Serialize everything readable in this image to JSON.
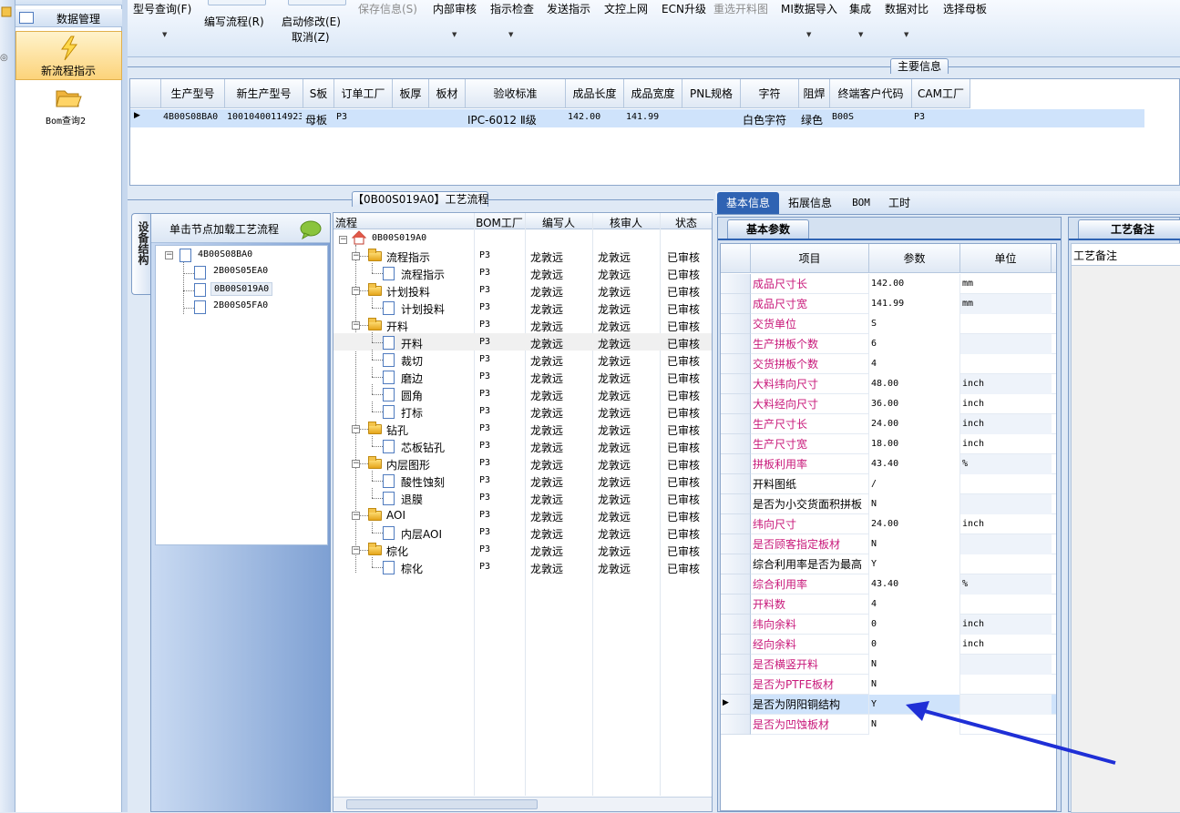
{
  "left_nav": {
    "top_partial": "... ",
    "data_mgmt": "数据管理",
    "new_flow": "新流程指示",
    "bom_query": "Bom查询2"
  },
  "toolbar": {
    "model_query": "型号查询(F)",
    "write_flow": "编写流程(R)",
    "start_modify": "启动修改(E)",
    "cancel": "取消(Z)",
    "save_info": "保存信息(S)",
    "internal_audit": "内部审核",
    "instruction_check": "指示检查",
    "send_instruction": "发送指示",
    "doc_online": "文控上网",
    "ecn_upgrade": "ECN升级",
    "reselect_panel": "重选开料图",
    "mi_import": "MI数据导入",
    "integrate": "集成",
    "data_compare": "数据对比",
    "select_master": "选择母板"
  },
  "main_info": {
    "title": "主要信息",
    "columns": [
      "生产型号",
      "新生产型号",
      "S板",
      "订单工厂",
      "板厚",
      "板材",
      "验收标准",
      "成品长度",
      "成品宽度",
      "PNL规格",
      "字符",
      "阻焊",
      "终端客户代码",
      "CAM工厂"
    ],
    "row": [
      "4B00S08BA0",
      "10010400114923",
      "母板",
      "P3",
      "",
      "",
      "IPC-6012 Ⅱ级",
      "142.00",
      "141.99",
      "",
      "白色字符",
      "绿色",
      "B00S",
      "P3"
    ]
  },
  "flow_panel": {
    "title": "【0B00S019A0】工艺流程",
    "side_tab": "设备结构",
    "hint": "单击节点加载工艺流程",
    "tree": [
      "4B00S08BA0",
      "2B00S05EA0",
      "0B00S019A0",
      "2B00S05FA0"
    ]
  },
  "flow_grid": {
    "columns": [
      "流程",
      "BOM工厂",
      "编写人",
      "核审人",
      "状态"
    ],
    "root": "0B00S019A0",
    "rows": [
      {
        "name": "流程指示",
        "type": "folder",
        "factory": "P3",
        "writer": "龙敦远",
        "auditor": "龙敦远",
        "status": "已审核"
      },
      {
        "name": "流程指示",
        "type": "doc",
        "factory": "P3",
        "writer": "龙敦远",
        "auditor": "龙敦远",
        "status": "已审核"
      },
      {
        "name": "计划投料",
        "type": "folder",
        "factory": "P3",
        "writer": "龙敦远",
        "auditor": "龙敦远",
        "status": "已审核"
      },
      {
        "name": "计划投料",
        "type": "doc",
        "factory": "P3",
        "writer": "龙敦远",
        "auditor": "龙敦远",
        "status": "已审核"
      },
      {
        "name": "开料",
        "type": "folder",
        "factory": "P3",
        "writer": "龙敦远",
        "auditor": "龙敦远",
        "status": "已审核"
      },
      {
        "name": "开料",
        "type": "doc",
        "factory": "P3",
        "writer": "龙敦远",
        "auditor": "龙敦远",
        "status": "已审核"
      },
      {
        "name": "裁切",
        "type": "doc",
        "factory": "P3",
        "writer": "龙敦远",
        "auditor": "龙敦远",
        "status": "已审核"
      },
      {
        "name": "磨边",
        "type": "doc",
        "factory": "P3",
        "writer": "龙敦远",
        "auditor": "龙敦远",
        "status": "已审核"
      },
      {
        "name": "圆角",
        "type": "doc",
        "factory": "P3",
        "writer": "龙敦远",
        "auditor": "龙敦远",
        "status": "已审核"
      },
      {
        "name": "打标",
        "type": "doc",
        "factory": "P3",
        "writer": "龙敦远",
        "auditor": "龙敦远",
        "status": "已审核"
      },
      {
        "name": "钻孔",
        "type": "folder",
        "factory": "P3",
        "writer": "龙敦远",
        "auditor": "龙敦远",
        "status": "已审核"
      },
      {
        "name": "芯板钻孔",
        "type": "doc",
        "factory": "P3",
        "writer": "龙敦远",
        "auditor": "龙敦远",
        "status": "已审核"
      },
      {
        "name": "内层图形",
        "type": "folder",
        "factory": "P3",
        "writer": "龙敦远",
        "auditor": "龙敦远",
        "status": "已审核"
      },
      {
        "name": "酸性蚀刻",
        "type": "doc",
        "factory": "P3",
        "writer": "龙敦远",
        "auditor": "龙敦远",
        "status": "已审核"
      },
      {
        "name": "退膜",
        "type": "doc",
        "factory": "P3",
        "writer": "龙敦远",
        "auditor": "龙敦远",
        "status": "已审核"
      },
      {
        "name": "AOI",
        "type": "folder",
        "factory": "P3",
        "writer": "龙敦远",
        "auditor": "龙敦远",
        "status": "已审核"
      },
      {
        "name": "内层AOI",
        "type": "doc",
        "factory": "P3",
        "writer": "龙敦远",
        "auditor": "龙敦远",
        "status": "已审核"
      },
      {
        "name": "棕化",
        "type": "folder",
        "factory": "P3",
        "writer": "龙敦远",
        "auditor": "龙敦远",
        "status": "已审核"
      },
      {
        "name": "棕化",
        "type": "doc",
        "factory": "P3",
        "writer": "龙敦远",
        "auditor": "龙敦远",
        "status": "已审核"
      }
    ]
  },
  "right_tabs": [
    "基本信息",
    "拓展信息",
    "BOM",
    "工时"
  ],
  "basic_params": {
    "title": "基本参数",
    "columns": [
      "项目",
      "参数",
      "单位"
    ],
    "rows": [
      {
        "name": "成品尺寸长",
        "value": "142.00",
        "unit": "mm",
        "pink": true
      },
      {
        "name": "成品尺寸宽",
        "value": "141.99",
        "unit": "mm",
        "pink": true
      },
      {
        "name": "交货单位",
        "value": "S",
        "unit": "",
        "pink": true
      },
      {
        "name": "生产拼板个数",
        "value": "6",
        "unit": "",
        "pink": true
      },
      {
        "name": "交货拼板个数",
        "value": "4",
        "unit": "",
        "pink": true
      },
      {
        "name": "大料纬向尺寸",
        "value": "48.00",
        "unit": "inch",
        "pink": true
      },
      {
        "name": "大料经向尺寸",
        "value": "36.00",
        "unit": "inch",
        "pink": true
      },
      {
        "name": "生产尺寸长",
        "value": "24.00",
        "unit": "inch",
        "pink": true
      },
      {
        "name": "生产尺寸宽",
        "value": "18.00",
        "unit": "inch",
        "pink": true
      },
      {
        "name": "拼板利用率",
        "value": "43.40",
        "unit": "%",
        "pink": true
      },
      {
        "name": "开料图纸",
        "value": "/",
        "unit": "",
        "pink": false
      },
      {
        "name": "是否为小交货面积拼板",
        "value": "N",
        "unit": "",
        "pink": false
      },
      {
        "name": "纬向尺寸",
        "value": "24.00",
        "unit": "inch",
        "pink": true
      },
      {
        "name": "是否顾客指定板材",
        "value": "N",
        "unit": "",
        "pink": true
      },
      {
        "name": "综合利用率是否为最高",
        "value": "Y",
        "unit": "",
        "pink": false
      },
      {
        "name": "综合利用率",
        "value": "43.40",
        "unit": "%",
        "pink": true
      },
      {
        "name": "开料数",
        "value": "4",
        "unit": "",
        "pink": true
      },
      {
        "name": "纬向余料",
        "value": "0",
        "unit": "inch",
        "pink": true
      },
      {
        "name": "经向余料",
        "value": "0",
        "unit": "inch",
        "pink": true
      },
      {
        "name": "是否横竖开料",
        "value": "N",
        "unit": "",
        "pink": true
      },
      {
        "name": "是否为PTFE板材",
        "value": "N",
        "unit": "",
        "pink": true
      },
      {
        "name": "是否为阴阳铜结构",
        "value": "Y",
        "unit": "",
        "pink": false
      },
      {
        "name": "是否为凹蚀板材",
        "value": "N",
        "unit": "",
        "pink": true
      }
    ]
  },
  "process_notes": {
    "tab": "工艺备注",
    "header": "工艺备注"
  },
  "colors": {
    "pink": "#c8187a",
    "selected": "#cfe3fb",
    "accent_arrow": "#1f2fd6"
  }
}
